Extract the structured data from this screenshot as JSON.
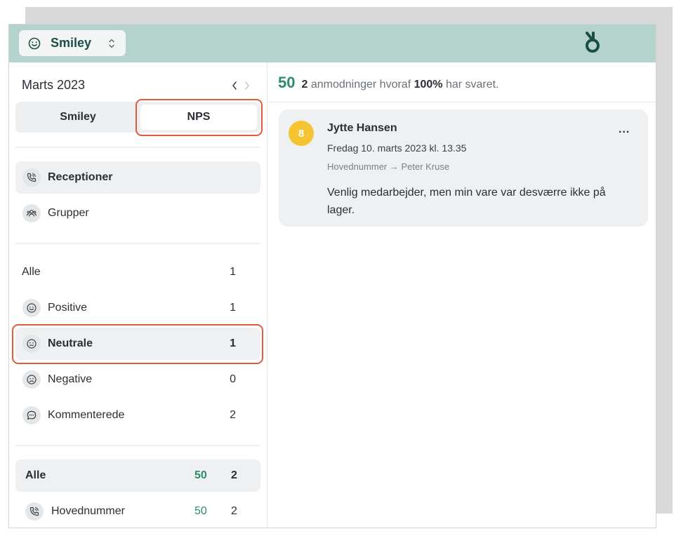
{
  "header": {
    "mode_label": "Smiley",
    "mode_icon": "smiley-icon",
    "logo": "brand-logo-icon"
  },
  "sidebar": {
    "month": "Marts 2023",
    "segment": {
      "smiley": "Smiley",
      "nps": "NPS",
      "selected": "NPS"
    },
    "views": [
      {
        "label": "Receptioner",
        "icon": "phone-icon",
        "active": true
      },
      {
        "label": "Grupper",
        "icon": "group-icon",
        "active": false
      }
    ],
    "filters": [
      {
        "label": "Alle",
        "count": "1"
      },
      {
        "label": "Positive",
        "count": "1",
        "icon": "smiley-happy-icon"
      },
      {
        "label": "Neutrale",
        "count": "1",
        "icon": "smiley-neutral-icon",
        "active": true
      },
      {
        "label": "Negative",
        "count": "0",
        "icon": "smiley-sad-icon"
      },
      {
        "label": "Kommenterede",
        "count": "2",
        "icon": "comment-icon"
      }
    ],
    "totals": [
      {
        "label": "Alle",
        "score": "50",
        "count": "2",
        "active": true
      },
      {
        "label": "Hovednummer",
        "score": "50",
        "count": "2",
        "icon": "phone-icon"
      }
    ]
  },
  "main": {
    "summary": {
      "score": "50",
      "count": "2",
      "text1": " anmodninger hvoraf ",
      "percent": "100%",
      "text2": " har svaret."
    },
    "responses": [
      {
        "score": "8",
        "name": "Jytte Hansen",
        "date": "Fredag 10. marts 2023 kl. 13.35",
        "route": "Hovednummer → Peter Kruse",
        "comment": "Venlig medarbejder, men min vare var desværre ikke på lager.",
        "menu": "..."
      }
    ]
  },
  "colors": {
    "topbar": "#b5d3cd",
    "accent": "#2e8a6a",
    "badge": "#f6c433",
    "highlight": "#e05a3c"
  }
}
